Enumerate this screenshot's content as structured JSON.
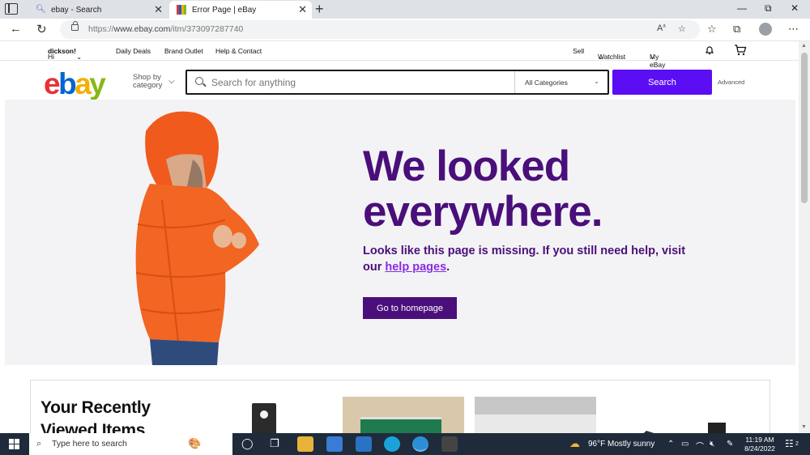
{
  "browser": {
    "tabs": [
      {
        "title": "ebay - Search"
      },
      {
        "title": "Error Page | eBay",
        "active": true
      }
    ],
    "url_prefix": "https://",
    "url_host": "www.ebay.com",
    "url_path": "/itm/373097287740",
    "window_controls": [
      "minimize",
      "restore",
      "close"
    ]
  },
  "topnav": {
    "greeting_prefix": "Hi ",
    "user": "dickson!",
    "daily_deals": "Daily Deals",
    "brand_outlet": "Brand Outlet",
    "help_contact": "Help & Contact",
    "sell": "Sell",
    "watchlist": "Watchlist",
    "my_ebay": "My eBay"
  },
  "header": {
    "logo_letters": [
      "e",
      "b",
      "a",
      "y"
    ],
    "shop_by_line1": "Shop by",
    "shop_by_line2": "category",
    "search_placeholder": "Search for anything",
    "category_selected": "All Categories",
    "search_button": "Search",
    "advanced": "Advanced"
  },
  "hero": {
    "title_line1": "We looked",
    "title_line2": "everywhere.",
    "subtitle_part1": "Looks like this page is missing. If you still need help, visit our ",
    "subtitle_link": "help pages",
    "subtitle_end": ".",
    "button": "Go to homepage"
  },
  "recent": {
    "title_line1": "Your Recently",
    "title_line2": "Viewed Items"
  },
  "taskbar": {
    "search_placeholder": "Type here to search",
    "weather": "96°F  Mostly sunny",
    "time": "11:19 AM",
    "date": "8/24/2022",
    "notifications": "2"
  },
  "colors": {
    "accent": "#5b0ef3",
    "hero_text": "#4a0f7a",
    "link": "#8a2be2"
  }
}
